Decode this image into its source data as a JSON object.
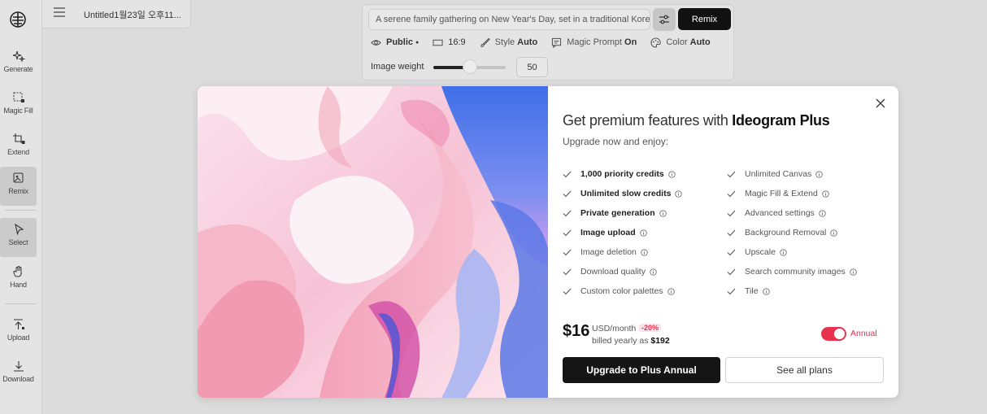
{
  "sidebar": {
    "logo_icon": "ideogram-logo-icon",
    "tools": [
      {
        "label": "Generate",
        "icon": "sparkles-icon"
      },
      {
        "label": "Magic Fill",
        "icon": "magic-fill-icon"
      },
      {
        "label": "Extend",
        "icon": "crop-extend-icon"
      },
      {
        "label": "Remix",
        "icon": "remix-image-icon"
      },
      {
        "label": "Select",
        "icon": "cursor-icon"
      },
      {
        "label": "Hand",
        "icon": "hand-icon"
      },
      {
        "label": "Upload",
        "icon": "upload-icon"
      },
      {
        "label": "Download",
        "icon": "download-icon"
      }
    ]
  },
  "header": {
    "doc_title": "Untitled1월23일 오후11...",
    "menu_icon": "hamburger-menu-icon"
  },
  "prompt": {
    "text": "A serene family gathering on New Year's Day, set in a traditional Korean",
    "remix_label": "Remix",
    "options": {
      "visibility": "Public",
      "aspect_ratio": "16:9",
      "style_label": "Style",
      "style_value": "Auto",
      "magic_prompt_label": "Magic Prompt",
      "magic_prompt_value": "On",
      "color_label": "Color",
      "color_value": "Auto"
    },
    "image_weight_label": "Image weight",
    "image_weight_value": "50",
    "image_weight_fraction": 0.5
  },
  "modal": {
    "title_prefix": "Get premium features with",
    "title_brand": "Ideogram Plus",
    "subtitle": "Upgrade now and enjoy:",
    "features_left": [
      {
        "text": "1,000 priority credits",
        "bold": true
      },
      {
        "text": "Unlimited slow credits",
        "bold": true
      },
      {
        "text": "Private generation",
        "bold": true
      },
      {
        "text": "Image upload",
        "bold": true
      },
      {
        "text": "Image deletion",
        "bold": false
      },
      {
        "text": "Download quality",
        "bold": false
      },
      {
        "text": "Custom color palettes",
        "bold": false
      }
    ],
    "features_right": [
      {
        "text": "Unlimited Canvas",
        "bold": false
      },
      {
        "text": "Magic Fill & Extend",
        "bold": false
      },
      {
        "text": "Advanced settings",
        "bold": false
      },
      {
        "text": "Background Removal",
        "bold": false
      },
      {
        "text": "Upscale",
        "bold": false
      },
      {
        "text": "Search community images",
        "bold": false
      },
      {
        "text": "Tile",
        "bold": false
      }
    ],
    "price": "$16",
    "price_unit": "USD/month",
    "discount": "-20%",
    "billed_prefix": "billed yearly as",
    "billed_amount": "$192",
    "toggle_label": "Annual",
    "toggle_on": true,
    "upgrade_label": "Upgrade to Plus Annual",
    "plans_label": "See all plans",
    "accent_color": "#e8334f"
  }
}
